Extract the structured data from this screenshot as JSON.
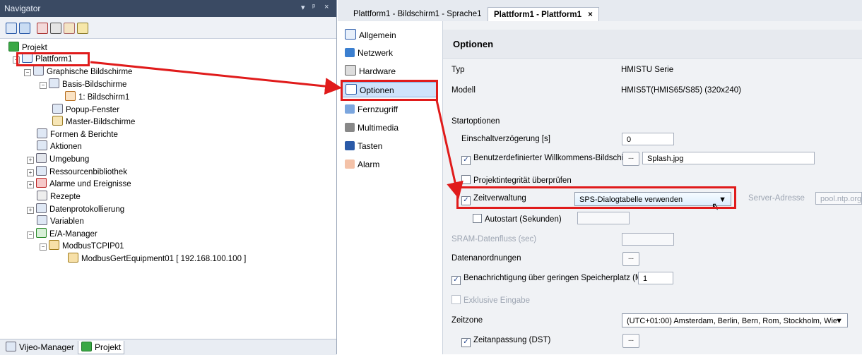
{
  "navigator": {
    "title": "Navigator",
    "controls": [
      "▾",
      "ᵖ",
      "×"
    ],
    "tree": [
      {
        "label": "Projekt"
      },
      {
        "label": "Plattform1"
      },
      {
        "label": "Graphische Bildschirme"
      },
      {
        "label": "Basis-Bildschirme"
      },
      {
        "label": "1: Bildschirm1"
      },
      {
        "label": "Popup-Fenster"
      },
      {
        "label": "Master-Bildschirme"
      },
      {
        "label": "Formen & Berichte"
      },
      {
        "label": "Aktionen"
      },
      {
        "label": "Umgebung"
      },
      {
        "label": "Ressourcenbibliothek"
      },
      {
        "label": "Alarme und Ereignisse"
      },
      {
        "label": "Rezepte"
      },
      {
        "label": "Datenprotokollierung"
      },
      {
        "label": "Variablen"
      },
      {
        "label": "E/A-Manager"
      },
      {
        "label": "ModbusTCPIP01"
      },
      {
        "label": "ModbusGertEquipment01 [ 192.168.100.100 ]"
      }
    ],
    "tabs": [
      "Vijeo-Manager",
      "Projekt"
    ]
  },
  "doc_tabs": [
    "Plattform1 - Bildschirm1 - Sprache1",
    "Plattform1 - Plattform1",
    "×"
  ],
  "categories": [
    "Allgemein",
    "Netzwerk",
    "Hardware",
    "Optionen",
    "Fernzugriff",
    "Multimedia",
    "Tasten",
    "Alarm"
  ],
  "panel": {
    "heading": "Optionen",
    "typ_label": "Typ",
    "typ_value": "HMISTU Serie",
    "modell_label": "Modell",
    "modell_value": "HMIS5T(HMIS65/S85) (320x240)",
    "startoptionen": "Startoptionen",
    "einschalt_label": "Einschaltverzögerung [s]",
    "einschalt_value": "0",
    "willkommen_label": "Benutzerdefinierter Willkommens-Bildschirm",
    "willkommen_value": "Splash.jpg",
    "integritaet_label": "Projektintegrität überprüfen",
    "zeit_label": "Zeitverwaltung",
    "zeit_select": "SPS-Dialogtabelle verwenden",
    "server_label": "Server-Adresse",
    "server_value": "pool.ntp.org",
    "autostart_label": "Autostart (Sekunden)",
    "sram_label": "SRAM-Datenfluss (sec)",
    "datenanordnungen_label": "Datenanordnungen",
    "benachrichtigung_label": "Benachrichtigung über geringen Speicherplatz (MB)",
    "benachrichtigung_value": "1",
    "exklusive_label": "Exklusive Eingabe",
    "zeitzone_label": "Zeitzone",
    "zeitzone_select": "(UTC+01:00) Amsterdam, Berlin, Bern, Rom, Stockholm, Wie",
    "dst_label": "Zeitanpassung (DST)",
    "ellipsis": "..."
  },
  "colors": {
    "highlight": "#e01b1b",
    "titlebar": "#3a4a63",
    "selection": "#cfe3fb"
  }
}
